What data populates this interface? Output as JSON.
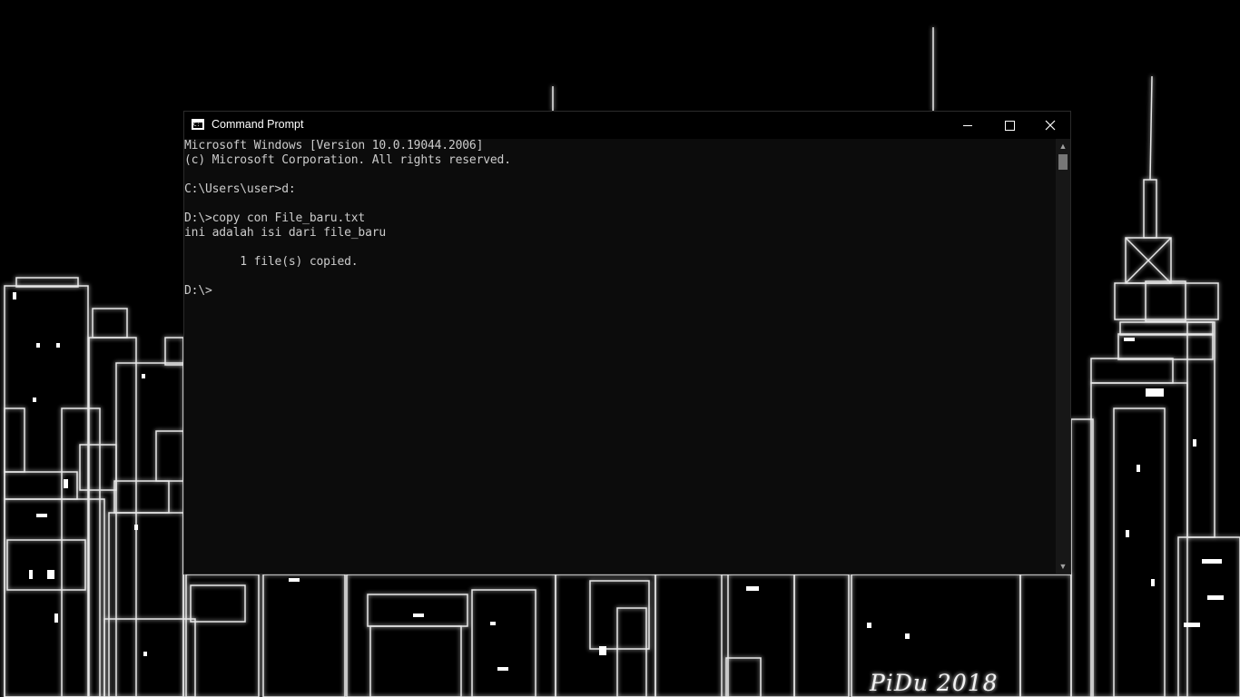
{
  "window": {
    "title": "Command Prompt",
    "icon": "cmd-icon"
  },
  "terminal": {
    "lines": [
      "Microsoft Windows [Version 10.0.19044.2006]",
      "(c) Microsoft Corporation. All rights reserved.",
      "",
      "C:\\Users\\user>d:",
      "",
      "D:\\>copy con File_baru.txt",
      "ini adalah isi dari file_baru",
      "",
      "        1 file(s) copied.",
      "",
      "D:\\>"
    ]
  },
  "wallpaper": {
    "signature": "PiDu 2018"
  },
  "colors": {
    "terminal_bg": "#0c0c0c",
    "terminal_text": "#cccccc",
    "titlebar_bg": "#000000"
  }
}
